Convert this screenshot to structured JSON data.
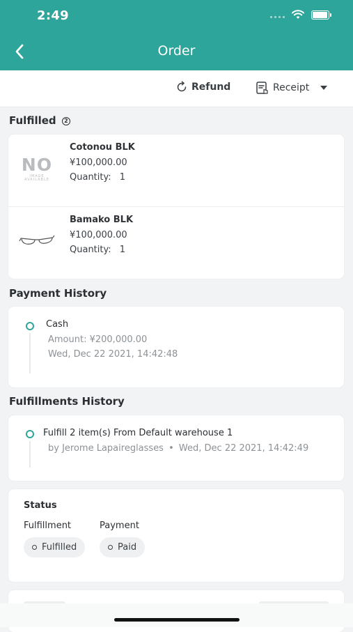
{
  "status_bar": {
    "time": "2:49"
  },
  "header": {
    "title": "Order"
  },
  "actions": {
    "refund": "Refund",
    "receipt": "Receipt"
  },
  "fulfilled": {
    "title": "Fulfilled",
    "count": "2",
    "items": [
      {
        "name": "Cotonou BLK",
        "price": "¥100,000.00",
        "quantity_label": "Quantity:",
        "quantity": "1",
        "thumb": "NO IMAGE AVAILABLE"
      },
      {
        "name": "Bamako BLK",
        "price": "¥100,000.00",
        "quantity_label": "Quantity:",
        "quantity": "1",
        "thumb": "glasses"
      }
    ]
  },
  "payment_history": {
    "title": "Payment History",
    "method": "Cash",
    "amount": "Amount: ¥200,000.00",
    "date": "Wed, Dec 22 2021, 14:42:48"
  },
  "fulfillments_history": {
    "title": "Fulfillments History",
    "line": "Fulfill 2 item(s) From Default warehouse 1",
    "by": "by Jerome Lapaireglasses",
    "separator": "•",
    "date": "Wed, Dec 22 2021, 14:42:49"
  },
  "status": {
    "title": "Status",
    "fulfillment_label": "Fulfillment",
    "payment_label": "Payment",
    "fulfillment_value": "Fulfilled",
    "payment_value": "Paid"
  },
  "colors": {
    "accent": "#2ea59a",
    "background": "#f2f3f4"
  }
}
